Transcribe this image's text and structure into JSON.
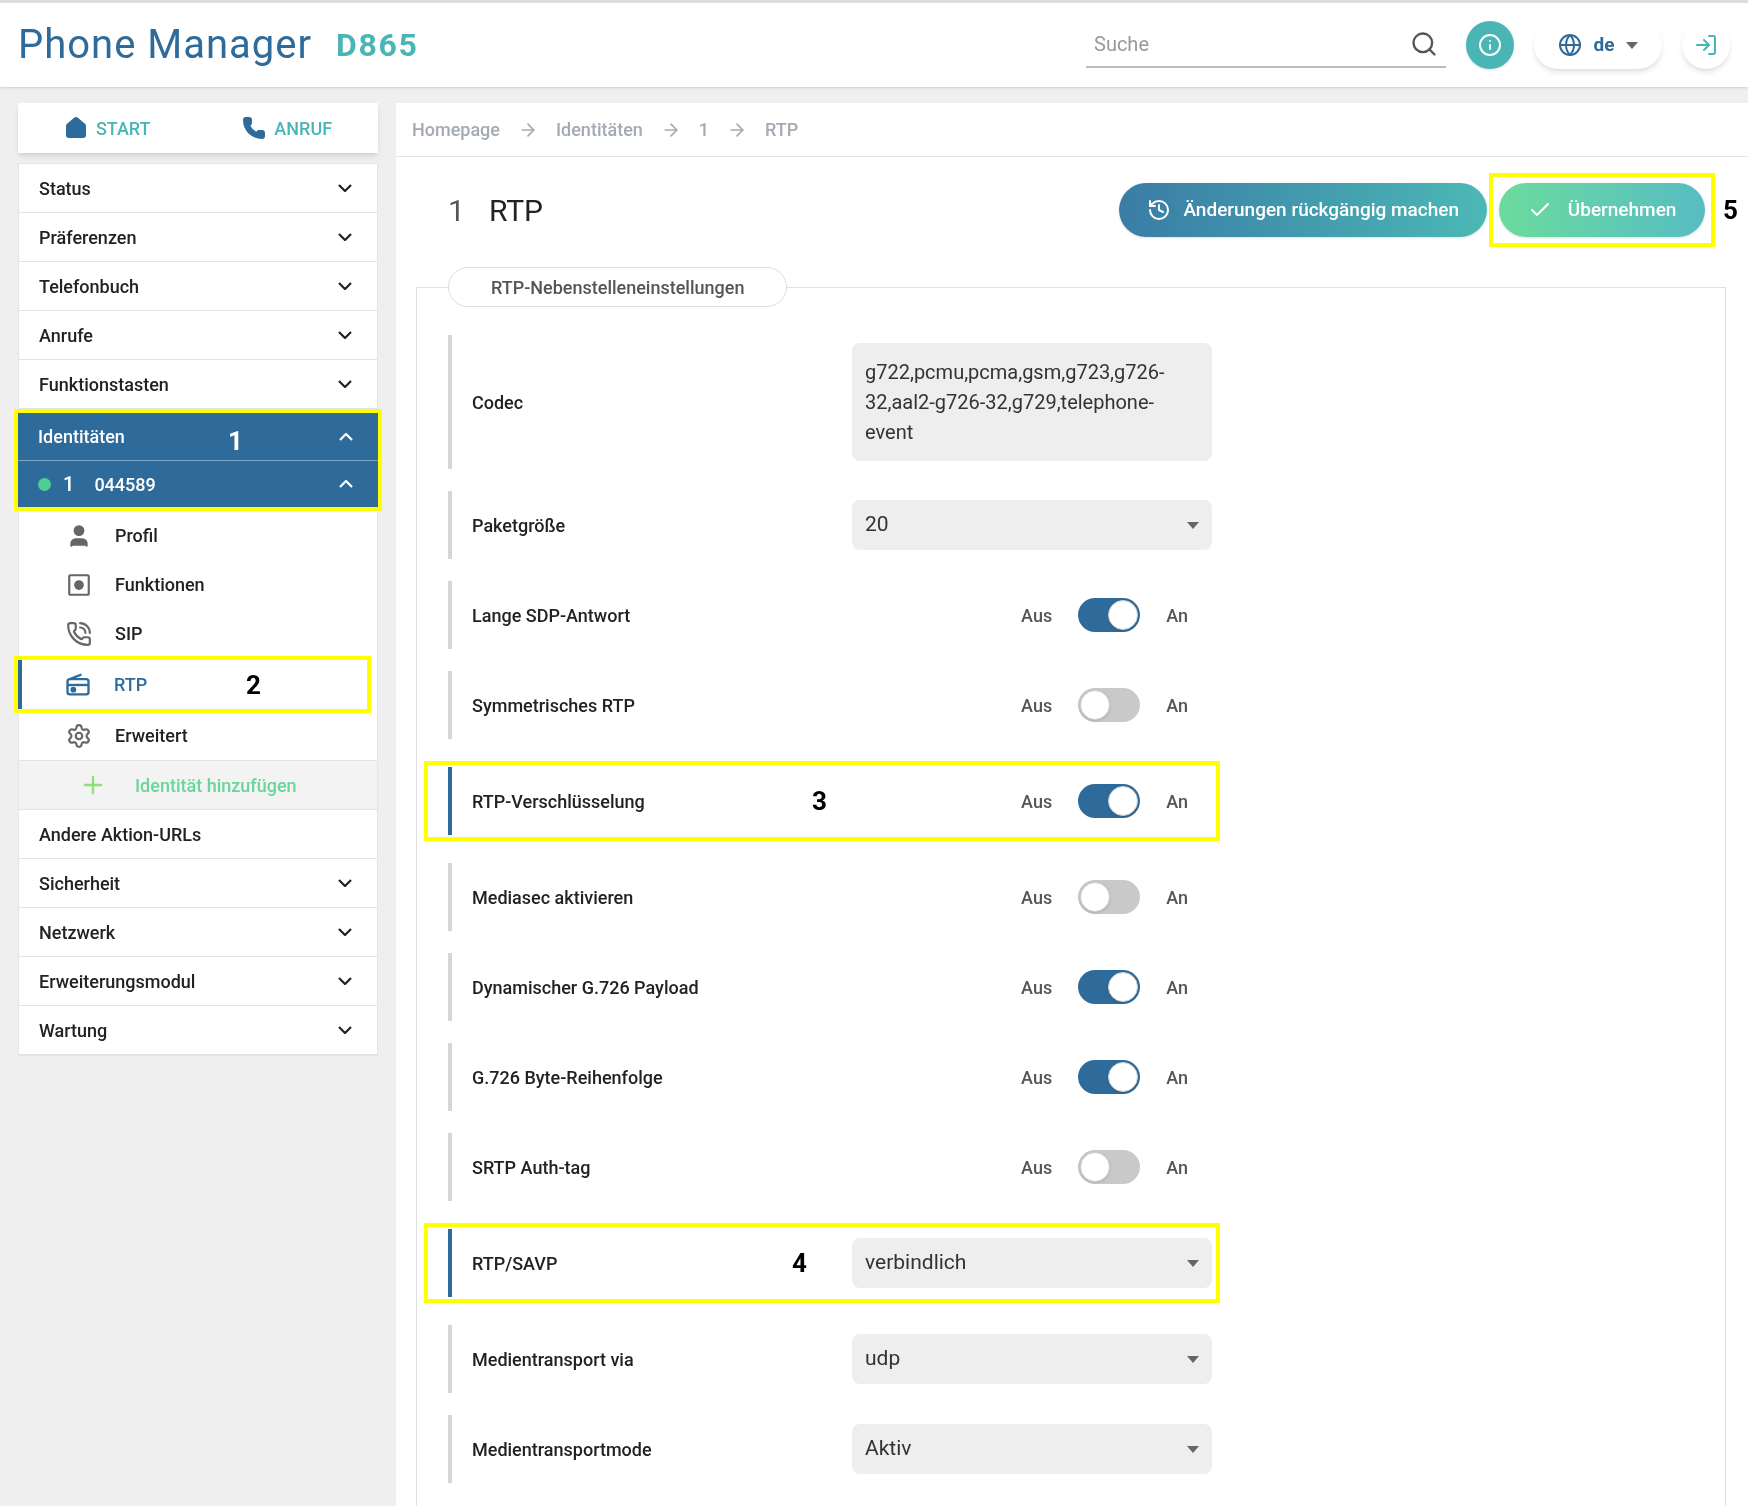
{
  "header": {
    "app_title": "Phone Manager",
    "model": "D865",
    "search": {
      "placeholder": "Suche"
    },
    "language": "de"
  },
  "nav_buttons": [
    {
      "label": "START",
      "kind": "home"
    },
    {
      "label": "ANRUF",
      "kind": "call"
    }
  ],
  "sidebar": {
    "items": [
      {
        "kind": "section",
        "label": "Status",
        "expanded": false
      },
      {
        "kind": "section",
        "label": "Präferenzen",
        "expanded": false
      },
      {
        "kind": "section",
        "label": "Telefonbuch",
        "expanded": false
      },
      {
        "kind": "section",
        "label": "Anrufe",
        "expanded": false
      },
      {
        "kind": "section",
        "label": "Funktionstasten",
        "expanded": false
      },
      {
        "kind": "identities",
        "label": "Identitäten",
        "expanded": true,
        "callout": "1",
        "identity": {
          "number": "1",
          "account": "044589",
          "expanded": true,
          "color": "#4ccf95"
        },
        "children": [
          {
            "kind": "person",
            "label": "Profil",
            "selected": false
          },
          {
            "kind": "gearbox",
            "label": "Funktionen",
            "selected": false
          },
          {
            "kind": "sip",
            "label": "SIP",
            "selected": false
          },
          {
            "kind": "radio",
            "label": "RTP",
            "selected": true,
            "callout": "2"
          },
          {
            "kind": "gear",
            "label": "Erweitert",
            "selected": false
          }
        ],
        "add_label": "Identität hinzufügen"
      },
      {
        "kind": "link",
        "label": "Andere Aktion-URLs"
      },
      {
        "kind": "section",
        "label": "Sicherheit",
        "expanded": false
      },
      {
        "kind": "section",
        "label": "Netzwerk",
        "expanded": false
      },
      {
        "kind": "section",
        "label": "Erweiterungsmodul",
        "expanded": false
      },
      {
        "kind": "section",
        "label": "Wartung",
        "expanded": false
      }
    ]
  },
  "breadcrumb": [
    "Homepage",
    "Identitäten",
    "1",
    "RTP"
  ],
  "page": {
    "number": "1",
    "title": "RTP",
    "revert_button": "Änderungen rückgängig machen",
    "apply_button": {
      "label": "Übernehmen",
      "callout": "5"
    }
  },
  "section_tab": "RTP-Nebenstelleneinstellungen",
  "settings": [
    {
      "kind": "text",
      "label": "Codec",
      "value": "g722,pcmu,pcma,gsm,g723,g726-32,aal2-g726-32,g729,telephone-event"
    },
    {
      "kind": "select",
      "label": "Paketgröße",
      "value": "20"
    },
    {
      "kind": "toggle",
      "label": "Lange SDP-Antwort",
      "off_label": "Aus",
      "on_label": "An",
      "on": true
    },
    {
      "kind": "toggle",
      "label": "Symmetrisches RTP",
      "off_label": "Aus",
      "on_label": "An",
      "on": false
    },
    {
      "kind": "toggle",
      "label": "RTP-Verschlüsselung",
      "off_label": "Aus",
      "on_label": "An",
      "on": true,
      "callout": "3"
    },
    {
      "kind": "toggle",
      "label": "Mediasec aktivieren",
      "off_label": "Aus",
      "on_label": "An",
      "on": false
    },
    {
      "kind": "toggle",
      "label": "Dynamischer G.726 Payload",
      "off_label": "Aus",
      "on_label": "An",
      "on": true
    },
    {
      "kind": "toggle",
      "label": "G.726 Byte-Reihenfolge",
      "off_label": "Aus",
      "on_label": "An",
      "on": true
    },
    {
      "kind": "toggle",
      "label": "SRTP Auth-tag",
      "off_label": "Aus",
      "on_label": "An",
      "on": false
    },
    {
      "kind": "select",
      "label": "RTP/SAVP",
      "value": "verbindlich",
      "callout": "4"
    },
    {
      "kind": "select",
      "label": "Medientransport via",
      "value": "udp"
    },
    {
      "kind": "select",
      "label": "Medientransportmode",
      "value": "Aktiv"
    }
  ]
}
